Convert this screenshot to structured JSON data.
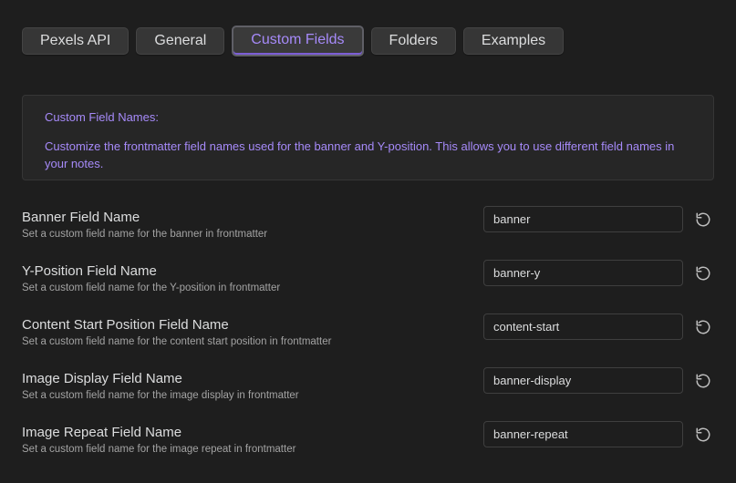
{
  "tabs": [
    {
      "label": "Pexels API",
      "active": false
    },
    {
      "label": "General",
      "active": false
    },
    {
      "label": "Custom Fields",
      "active": true
    },
    {
      "label": "Folders",
      "active": false
    },
    {
      "label": "Examples",
      "active": false
    }
  ],
  "info": {
    "title": "Custom Field Names:",
    "description": "Customize the frontmatter field names used for the banner and Y-position. This allows you to use different field names in your notes."
  },
  "settings": [
    {
      "name": "Banner Field Name",
      "description": "Set a custom field name for the banner in frontmatter",
      "value": "banner",
      "reset_icon": "reset-icon"
    },
    {
      "name": "Y-Position Field Name",
      "description": "Set a custom field name for the Y-position in frontmatter",
      "value": "banner-y",
      "reset_icon": "reset-icon"
    },
    {
      "name": "Content Start Position Field Name",
      "description": "Set a custom field name for the content start position in frontmatter",
      "value": "content-start",
      "reset_icon": "reset-icon"
    },
    {
      "name": "Image Display Field Name",
      "description": "Set a custom field name for the image display in frontmatter",
      "value": "banner-display",
      "reset_icon": "reset-icon"
    },
    {
      "name": "Image Repeat Field Name",
      "description": "Set a custom field name for the image repeat in frontmatter",
      "value": "banner-repeat",
      "reset_icon": "reset-icon"
    }
  ],
  "colors": {
    "background": "#1e1e1e",
    "accent": "#a68af9",
    "text": "#dcddde",
    "muted_text": "#a3a3a3",
    "tab_background": "#363636"
  }
}
